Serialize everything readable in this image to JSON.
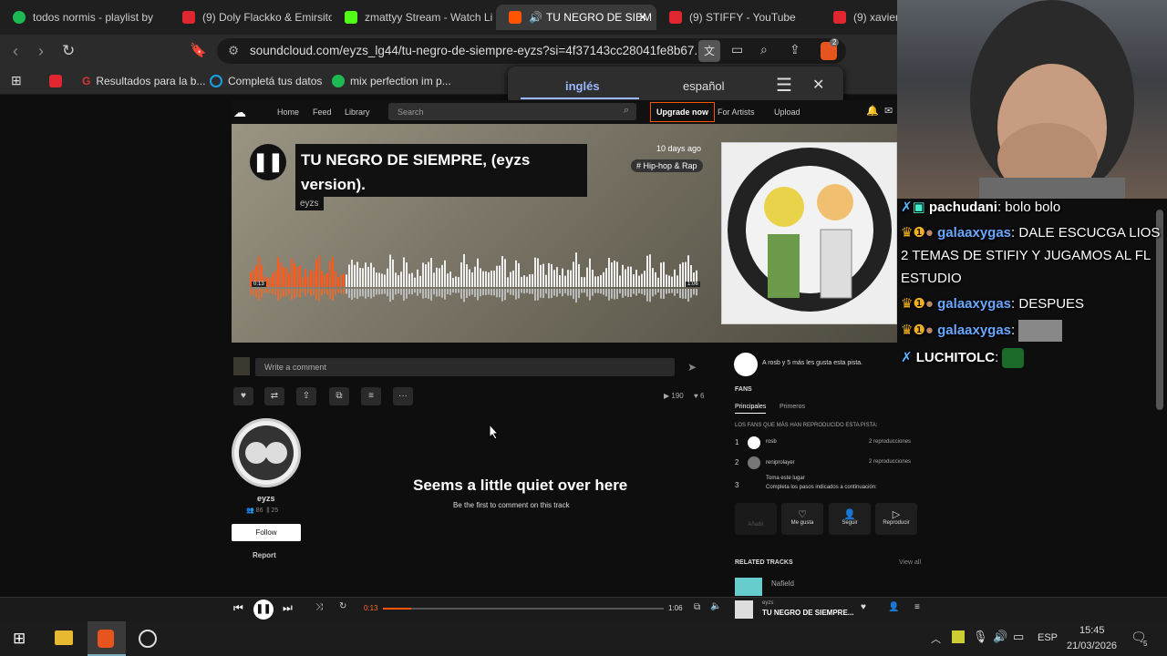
{
  "tabs": [
    {
      "label": "todos normis - playlist by",
      "color": "#1db954"
    },
    {
      "label": "(9) Doly Flackko & Emirsito",
      "color": "#e0262e"
    },
    {
      "label": "zmattyy Stream - Watch Li",
      "color": "#53fc18"
    },
    {
      "label": "TU NEGRO DE SIEM",
      "color": "#ff5500"
    },
    {
      "label": "(9) STIFFY - YouTube",
      "color": "#e0262e"
    },
    {
      "label": "(9) xavier",
      "color": "#e0262e"
    }
  ],
  "address": {
    "url": "soundcloud.com/eyzs_lg44/tu-negro-de-siempre-eyzs?si=4f37143cc28041fe8b67...",
    "ext_badge": "2"
  },
  "bookmarks": [
    {
      "label": "",
      "color": "#e0262e"
    },
    {
      "label": "Resultados para la b...",
      "color": "#d33"
    },
    {
      "label": "Completá tus datos",
      "color": "#1aa0e0"
    },
    {
      "label": "mix perfection im p...",
      "color": "#1db954"
    }
  ],
  "translate": {
    "lang1": "inglés",
    "lang2": "español"
  },
  "sc": {
    "nav": [
      "Home",
      "Feed",
      "Library"
    ],
    "search_placeholder": "Search",
    "upgrade": "Upgrade now",
    "for_artists": "For Artists",
    "upload": "Upload",
    "track_title_1": "TU NEGRO DE SIEMPRE, (eyzs",
    "track_title_2": "version).",
    "artist": "eyzs",
    "posted": "10 days ago",
    "tag": "# Hip-hop & Rap",
    "time_start": "0:13",
    "time_end": "1:06",
    "comment_placeholder": "Write a comment",
    "plays": "190",
    "likes": "6",
    "quiet_title": "Seems a little quiet over here",
    "quiet_sub": "Be the first to comment on this track",
    "user_name": "eyzs",
    "followers": "86",
    "tracks": "25",
    "follow": "Follow",
    "report": "Report",
    "likes_text": "A rosb y 5 más les gusta esta pista.",
    "fans": "FANS",
    "fans_tab1": "Principales",
    "fans_tab2": "Primeros",
    "fans_desc": "LOS FANS QUE MÁS HAN REPRODUCIDO ESTA PISTA:",
    "fan_rows": [
      {
        "rank": "1",
        "name": "rosb",
        "plays": "2 reproducciones"
      },
      {
        "rank": "2",
        "name": "reniprolayer",
        "plays": "2 reproducciones"
      },
      {
        "rank": "3",
        "name": "Toma este lugar",
        "plays": "Completa los pasos indicados a continuación:"
      }
    ],
    "actions": [
      "Añadir",
      "Me gusta",
      "Seguir",
      "Reproducir"
    ],
    "related": "RELATED TRACKS",
    "view_all": "View all",
    "related_artist": "Nafield"
  },
  "player": {
    "time_cur": "0:13",
    "time_total": "1:06",
    "progress": 0.1,
    "artist": "eyzs",
    "title": "TU NEGRO DE SIEMPRE..."
  },
  "chat": [
    {
      "user": "pachudani",
      "msg": "bolo bolo",
      "color": "#ffffff"
    },
    {
      "user": "galaaxygas",
      "msg": "DALE ESCUCGA LIOS 2 TEMAS DE STIFIY Y JUGAMOS AL FL ESTUDIO",
      "color": "#4f8cff"
    },
    {
      "user": "galaaxygas",
      "msg": "DESPUES",
      "color": "#4f8cff"
    },
    {
      "user": "galaaxygas",
      "msg": "",
      "color": "#4f8cff"
    },
    {
      "user": "LUCHITOLC",
      "msg": "",
      "color": "#ffffff"
    }
  ],
  "taskbar": {
    "lang": "ESP",
    "time": "15:45",
    "date": "21/03/2026",
    "notif": "5"
  }
}
